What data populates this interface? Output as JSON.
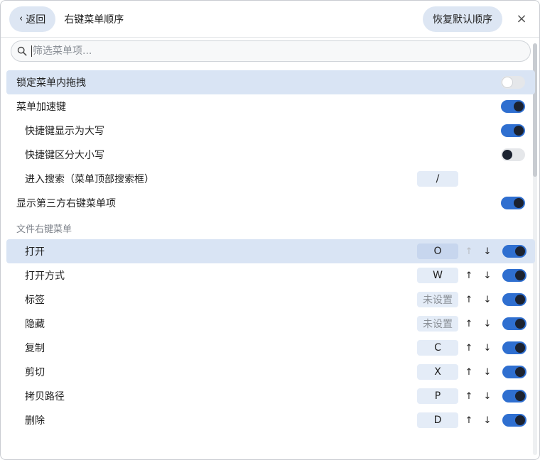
{
  "header": {
    "back_label": "返回",
    "back_chevron": "‹",
    "title": "右键菜单顺序",
    "restore_label": "恢复默认顺序",
    "close_glyph": "×"
  },
  "search": {
    "placeholder": "筛选菜单项..."
  },
  "settings": [
    {
      "label": "锁定菜单内拖拽",
      "enabled": false
    },
    {
      "label": "菜单加速键",
      "enabled": true
    },
    {
      "label": "快捷键显示为大写",
      "enabled": true
    },
    {
      "label": "快捷键区分大小写",
      "enabled": false
    },
    {
      "label": "进入搜索（菜单顶部搜索框）",
      "key": "/"
    },
    {
      "label": "显示第三方右键菜单项",
      "enabled": true
    }
  ],
  "section": {
    "title": "文件右键菜单"
  },
  "file_menu": [
    {
      "label": "打开",
      "key": "O",
      "enabled": true
    },
    {
      "label": "打开方式",
      "key": "W",
      "enabled": true
    },
    {
      "label": "标签",
      "key": "未设置",
      "enabled": true
    },
    {
      "label": "隐藏",
      "key": "未设置",
      "enabled": true
    },
    {
      "label": "复制",
      "key": "C",
      "enabled": true
    },
    {
      "label": "剪切",
      "key": "X",
      "enabled": true
    },
    {
      "label": "拷贝路径",
      "key": "P",
      "enabled": true
    },
    {
      "label": "删除",
      "key": "D",
      "enabled": true
    }
  ],
  "arrows": {
    "up": "↑",
    "down": "↓"
  },
  "colors": {
    "accent": "#2f6fd0",
    "highlight": "#d9e4f4",
    "key_bg": "#e4ecf7"
  }
}
